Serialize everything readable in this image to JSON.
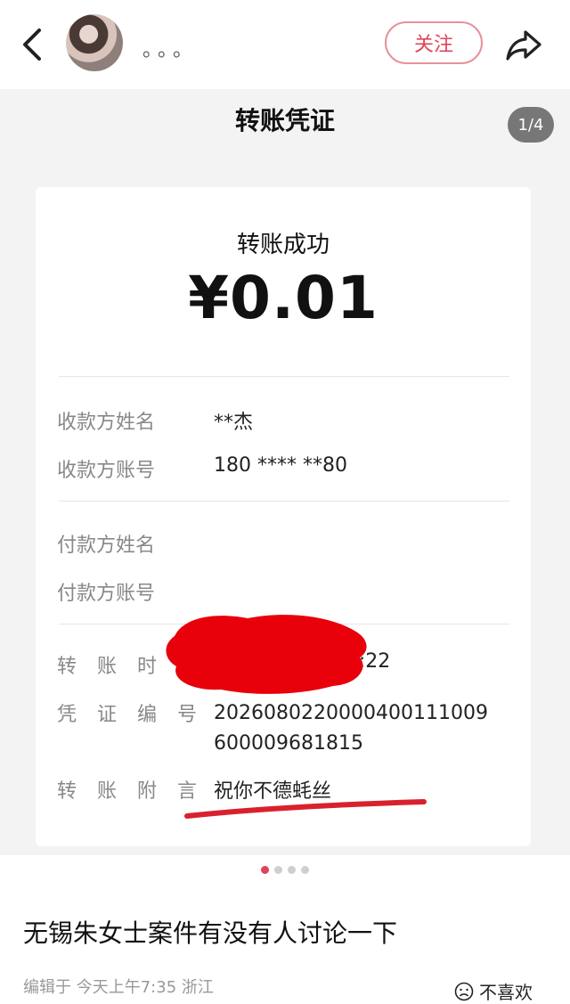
{
  "header": {
    "username": "。。。",
    "follow_label": "关注"
  },
  "photo": {
    "title": "转账凭证",
    "page_indicator": "1/4",
    "receipt": {
      "status": "转账成功",
      "amount": "¥0.01",
      "payee_name_label": "收款方姓名",
      "payee_name": "**杰",
      "payee_account_label": "收款方账号",
      "payee_account": "180 **** **80",
      "payer_name_label": "付款方姓名",
      "payer_account_label": "付款方账号",
      "time_label": "转 账 时 间",
      "time": "2026-08-02 00:22",
      "voucher_label": "凭 证 编 号",
      "voucher_number": "2026080220000400111009600009681815",
      "note_label": "转 账 附 言",
      "note": "祝你不德蚝丝"
    },
    "total_images": 4,
    "current_image": 1
  },
  "post": {
    "title": "无锡朱女士案件有没有人讨论一下",
    "meta": "编辑于 今天上午7:35 浙江",
    "dislike_label": "不喜欢"
  },
  "colors": {
    "accent": "#e0445a",
    "redaction": "#e8000a"
  },
  "icons": {
    "back": "back-arrow-icon",
    "share": "share-arrow-icon",
    "dislike": "sad-face-icon"
  }
}
